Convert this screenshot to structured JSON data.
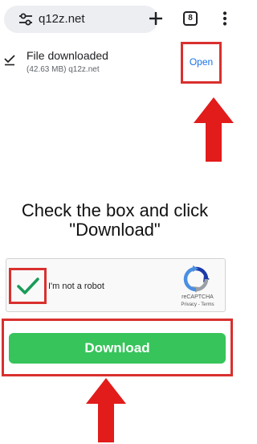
{
  "browser": {
    "url": "q12z.net",
    "tab_count": "8"
  },
  "download": {
    "title": "File downloaded",
    "details": "(42.63 MB) q12z.net",
    "open_label": "Open"
  },
  "page": {
    "instruction_line1": "Check the box and click",
    "instruction_line2": "\"Download\"",
    "captcha_label": "I'm not a robot",
    "captcha_brand": "reCAPTCHA",
    "captcha_terms": "Privacy - Terms",
    "captcha_checked": true,
    "download_button": "Download"
  },
  "colors": {
    "highlight_red": "#d9302e",
    "download_green": "#37c45a",
    "check_green": "#1a9c59",
    "link_blue": "#1a73e8"
  },
  "icons": [
    "tune-icon",
    "plus-icon",
    "more-vert-icon",
    "download-done-icon",
    "checkmark-icon",
    "recaptcha-logo",
    "red-up-arrow"
  ]
}
